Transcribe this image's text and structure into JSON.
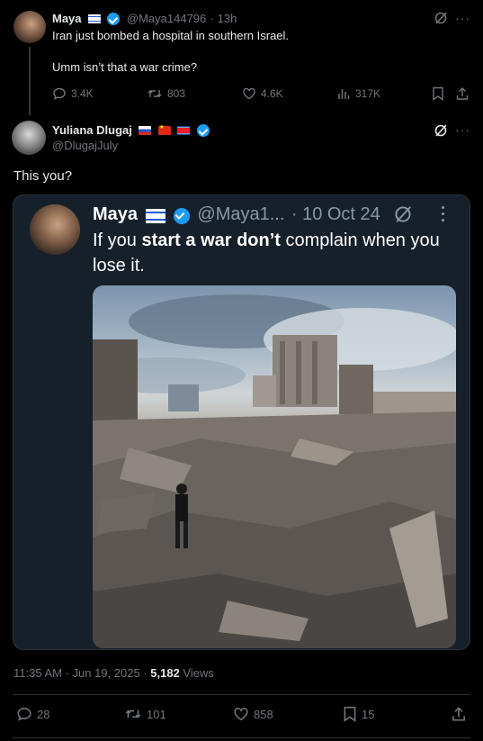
{
  "parent_tweet": {
    "name": "Maya",
    "handle": "@Maya144796",
    "time": "· 13h",
    "line1": "Iran just bombed a hospital in southern Israel.",
    "line2": "Umm isn’t that a war crime?",
    "replies": "3.4K",
    "retweets": "803",
    "likes": "4.6K",
    "views": "317K"
  },
  "main_tweet": {
    "name": "Yuliana Dlugaj",
    "handle": "@DlugajJuly",
    "text": "This you?",
    "timestamp": "11:35 AM · Jun 19, 2025 · ",
    "views_count": "5,182",
    "views_label": " Views",
    "replies": "28",
    "retweets": "101",
    "likes": "858",
    "bookmarks": "15"
  },
  "quoted": {
    "name": "Maya",
    "handle": "@Maya1...",
    "date": "· 10 Oct 24",
    "text_part1": "If you ",
    "text_bold1": "start a war don’t",
    "text_part2": " complain when you lose it."
  },
  "colors": {
    "background": "#000000",
    "accent": "#1d9bf0",
    "muted": "#71767b",
    "card": "#15202b"
  }
}
